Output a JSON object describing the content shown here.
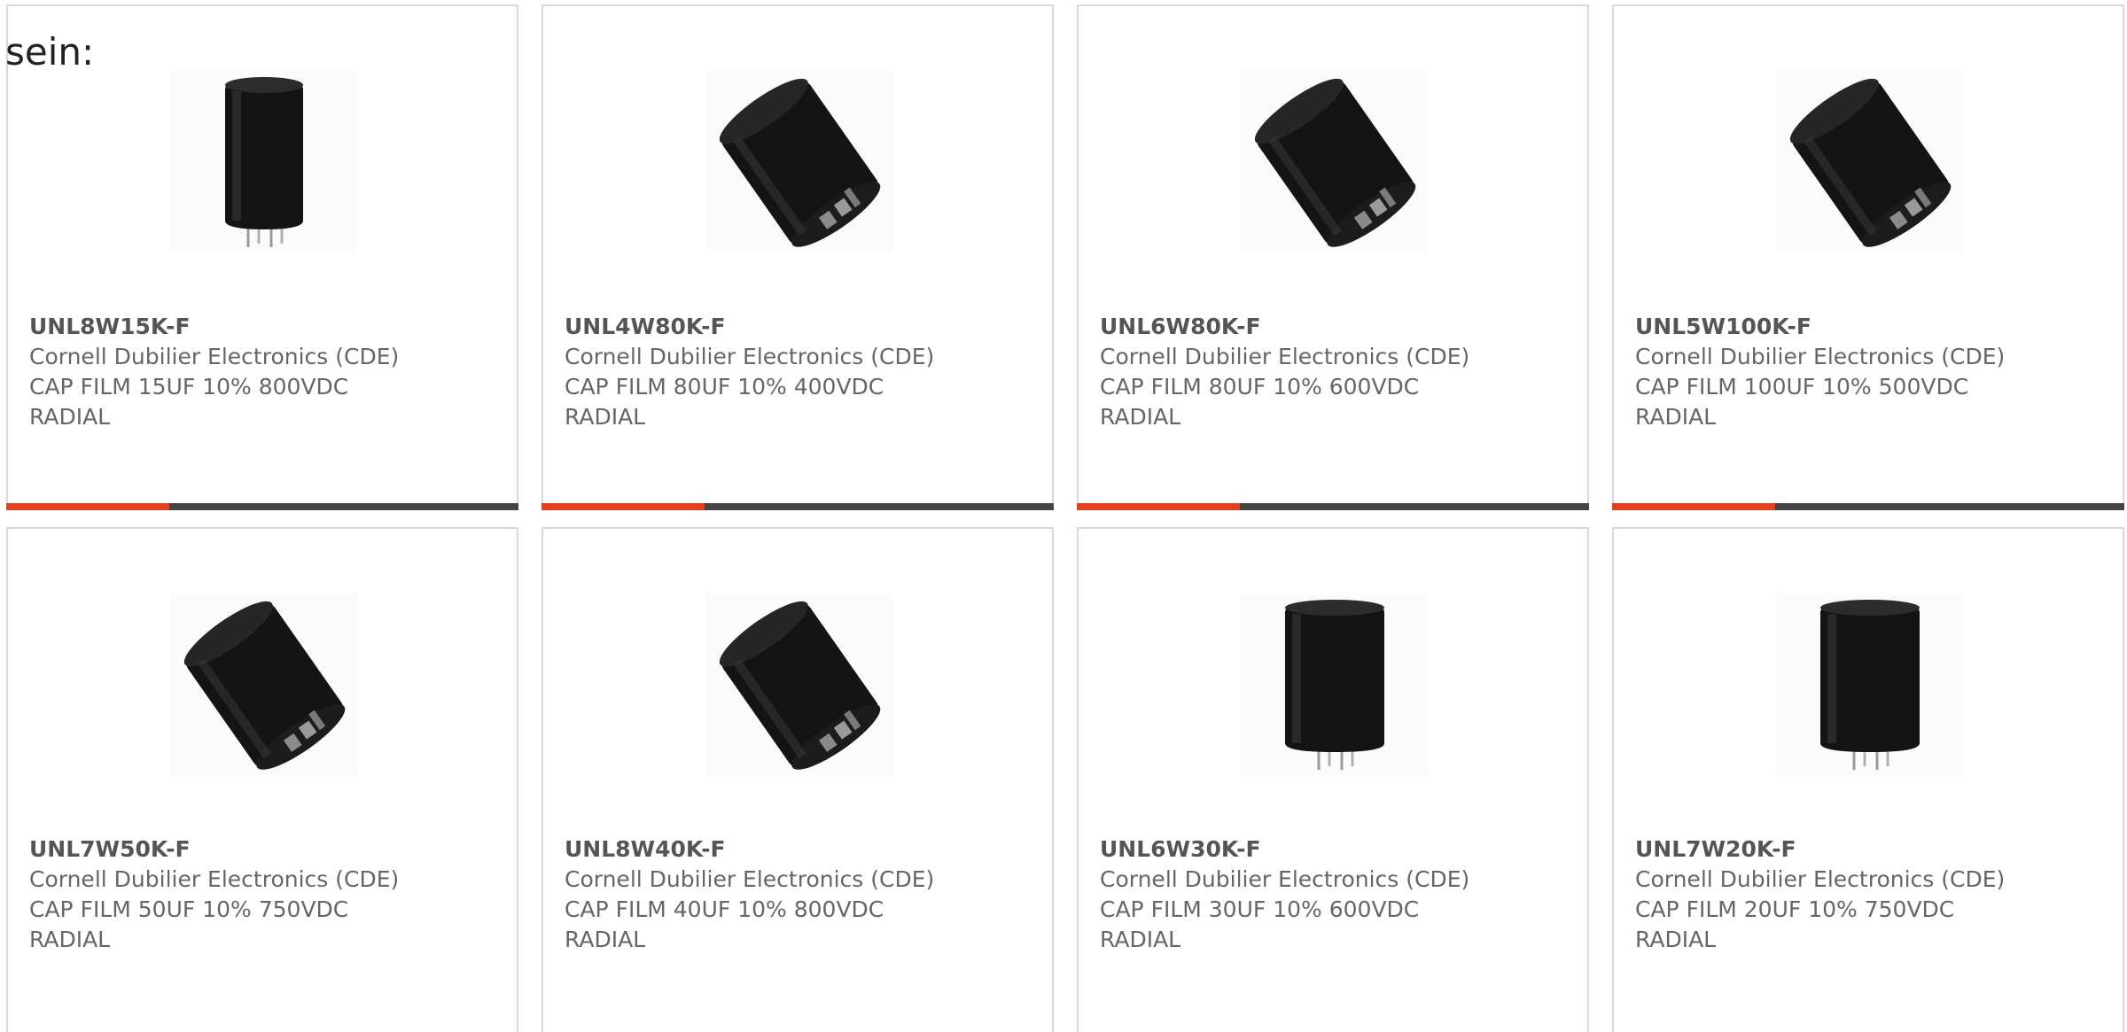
{
  "intro_text": "sein:",
  "colors": {
    "accent": "#e2401c",
    "bar": "#444444",
    "border": "#d9d9d9",
    "text": "#666666"
  },
  "products": [
    {
      "part_number": "UNL8W15K-F",
      "manufacturer": "Cornell Dubilier Electronics (CDE)",
      "description": "CAP FILM 15UF 10% 800VDC",
      "mounting": "RADIAL",
      "image_icon": "capacitor-upright-icon"
    },
    {
      "part_number": "UNL4W80K-F",
      "manufacturer": "Cornell Dubilier Electronics (CDE)",
      "description": "CAP FILM 80UF 10% 400VDC",
      "mounting": "RADIAL",
      "image_icon": "capacitor-tilted-icon"
    },
    {
      "part_number": "UNL6W80K-F",
      "manufacturer": "Cornell Dubilier Electronics (CDE)",
      "description": "CAP FILM 80UF 10% 600VDC",
      "mounting": "RADIAL",
      "image_icon": "capacitor-tilted-icon"
    },
    {
      "part_number": "UNL5W100K-F",
      "manufacturer": "Cornell Dubilier Electronics (CDE)",
      "description": "CAP FILM 100UF 10% 500VDC",
      "mounting": "RADIAL",
      "image_icon": "capacitor-tilted-icon"
    },
    {
      "part_number": "UNL7W50K-F",
      "manufacturer": "Cornell Dubilier Electronics (CDE)",
      "description": "CAP FILM 50UF 10% 750VDC",
      "mounting": "RADIAL",
      "image_icon": "capacitor-tilted-icon"
    },
    {
      "part_number": "UNL8W40K-F",
      "manufacturer": "Cornell Dubilier Electronics (CDE)",
      "description": "CAP FILM 40UF 10% 800VDC",
      "mounting": "RADIAL",
      "image_icon": "capacitor-tilted-icon"
    },
    {
      "part_number": "UNL6W30K-F",
      "manufacturer": "Cornell Dubilier Electronics (CDE)",
      "description": "CAP FILM 30UF 10% 600VDC",
      "mounting": "RADIAL",
      "image_icon": "capacitor-upright-icon"
    },
    {
      "part_number": "UNL7W20K-F",
      "manufacturer": "Cornell Dubilier Electronics (CDE)",
      "description": "CAP FILM 20UF 10% 750VDC",
      "mounting": "RADIAL",
      "image_icon": "capacitor-upright-icon"
    }
  ]
}
